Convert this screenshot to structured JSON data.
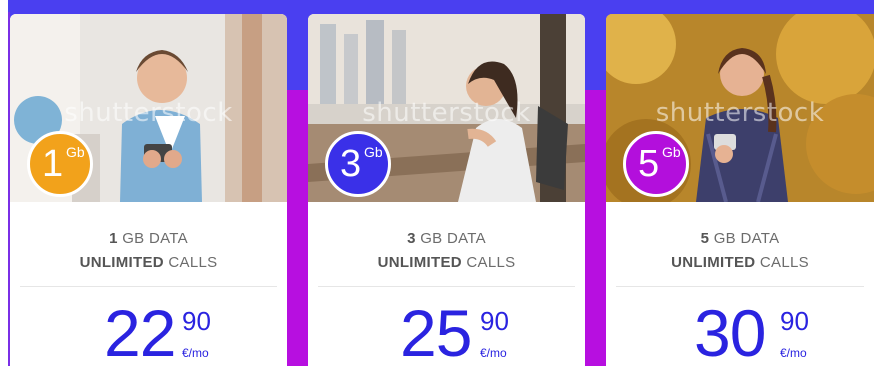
{
  "watermark": "shutterstock",
  "plans": [
    {
      "badge_number": "1",
      "badge_unit": "Gb",
      "data_amount": "1",
      "data_suffix": " GB DATA",
      "calls_strong": "UNLIMITED",
      "calls_suffix": " CALLS",
      "price_whole": "22",
      "price_cents": "90",
      "price_period": "€/mo",
      "badge_color": "#f2a21b"
    },
    {
      "badge_number": "3",
      "badge_unit": "Gb",
      "data_amount": "3",
      "data_suffix": " GB DATA",
      "calls_strong": "UNLIMITED",
      "calls_suffix": " CALLS",
      "price_whole": "25",
      "price_cents": "90",
      "price_period": "€/mo",
      "badge_color": "#3a30e8"
    },
    {
      "badge_number": "5",
      "badge_unit": "Gb",
      "data_amount": "5",
      "data_suffix": " GB DATA",
      "calls_strong": "UNLIMITED",
      "calls_suffix": " CALLS",
      "price_whole": "30",
      "price_cents": "90",
      "price_period": "€/mo",
      "badge_color": "#b30fdc"
    }
  ],
  "colors": {
    "accent_blue": "#3a30e8",
    "accent_purple": "#b30fdc",
    "price_text": "#2a23e0"
  }
}
